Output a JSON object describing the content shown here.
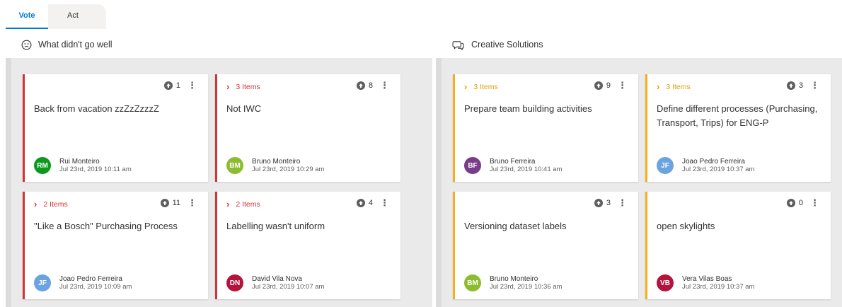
{
  "tabs": {
    "vote": "Vote",
    "act": "Act"
  },
  "columns": [
    {
      "title": "What didn't go well",
      "icon": "frown-face-icon"
    },
    {
      "title": "Creative Solutions",
      "icon": "chat-bubbles-icon"
    }
  ],
  "cards": [
    {
      "items": "",
      "votes": "1",
      "title": "Back from vacation zzZzZzzzZ",
      "initials": "RM",
      "name": "Rui Monteiro",
      "date": "Jul 23rd, 2019 10:11 am",
      "avatar_color": "#0b9a1b"
    },
    {
      "items": "3 Items",
      "votes": "8",
      "title": "Not IWC",
      "initials": "BM",
      "name": "Bruno Monteiro",
      "date": "Jul 23rd, 2019 10:29 am",
      "avatar_color": "#8cbd2f"
    },
    {
      "items": "2 Items",
      "votes": "11",
      "title": "\"Like a Bosch\" Purchasing Process",
      "initials": "JF",
      "name": "Joao Pedro Ferreira",
      "date": "Jul 23rd, 2019 10:09 am",
      "avatar_color": "#6aa3e0"
    },
    {
      "items": "2 Items",
      "votes": "4",
      "title": "Labelling wasn't uniform",
      "initials": "DN",
      "name": "David Vila Nova",
      "date": "Jul 23rd, 2019 10:07 am",
      "avatar_color": "#b4143c"
    },
    {
      "items": "3 Items",
      "votes": "9",
      "title": "Prepare team building activities",
      "initials": "BF",
      "name": "Bruno Ferreira",
      "date": "Jul 23rd, 2019 10:41 am",
      "avatar_color": "#7a3b89"
    },
    {
      "items": "3 Items",
      "votes": "3",
      "title": "Define different processes (Purchasing, Transport, Trips) for ENG-P",
      "initials": "JF",
      "name": "Joao Pedro Ferreira",
      "date": "Jul 23rd, 2019 10:37 am",
      "avatar_color": "#6aa3e0"
    },
    {
      "items": "",
      "votes": "3",
      "title": "Versioning dataset labels",
      "initials": "BM",
      "name": "Bruno Monteiro",
      "date": "Jul 23rd, 2019 10:36 am",
      "avatar_color": "#8cbd2f"
    },
    {
      "items": "",
      "votes": "0",
      "title": "open skylights",
      "initials": "VB",
      "name": "Vera Vilas Boas",
      "date": "Jul 23rd, 2019 10:37 am",
      "avatar_color": "#b4143c"
    }
  ],
  "colors": {
    "accent": "#0078d4",
    "red": "#d13438",
    "yellow": "#f2b01e"
  }
}
